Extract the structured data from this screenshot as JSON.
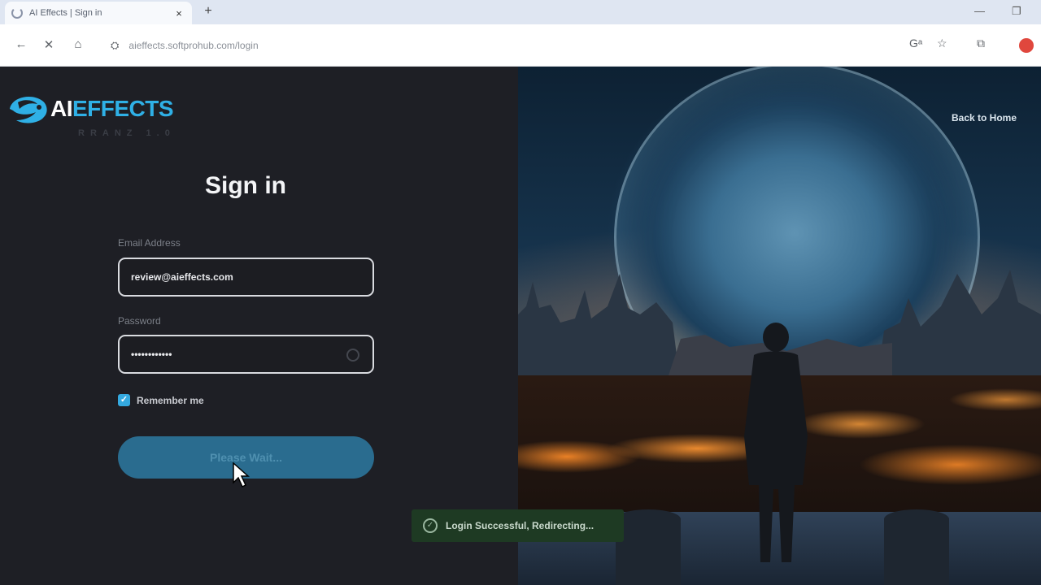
{
  "browser": {
    "tab_title": "AI Effects | Sign in",
    "tab_close": "×",
    "new_tab": "+",
    "minimize": "—",
    "restore": "❐",
    "url": "aieffects.softprohub.com/login",
    "nav_back": "←",
    "nav_stop": "✕",
    "nav_home": "⌂",
    "site_info": "⛭",
    "translate": "Gᵃ",
    "bookmark": "☆",
    "extensions": "⧉"
  },
  "logo": {
    "ai": "AI",
    "effects": "EFFECTS",
    "subtitle": "RRANZ 1.0"
  },
  "form": {
    "title": "Sign in",
    "email_label": "Email Address",
    "email_value": "review@aieffects.com",
    "password_label": "Password",
    "password_value": "••••••••••••",
    "remember_label": "Remember me",
    "submit_label": "Please Wait..."
  },
  "hero": {
    "back_home": "Back to Home"
  },
  "toast": {
    "message": "Login Successful, Redirecting..."
  },
  "colors": {
    "accent": "#2fb0e6",
    "button": "#2a6c8f",
    "toast_bg": "#1e3a23",
    "panel_bg": "#1e1f25"
  }
}
